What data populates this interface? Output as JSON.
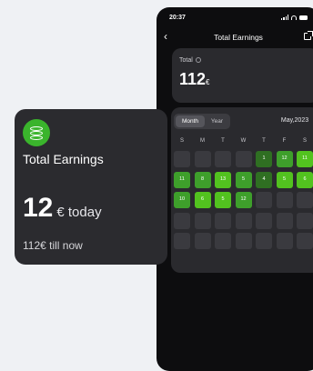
{
  "status_bar": {
    "time": "20:37"
  },
  "header": {
    "title": "Total Earnings",
    "back_icon": "chevron-left-icon",
    "share_icon": "share-icon"
  },
  "total_card": {
    "label": "Total",
    "info_icon": "info-icon",
    "value": "112",
    "currency": "€"
  },
  "calendar": {
    "tabs": [
      "Month",
      "Year"
    ],
    "active_tab": "Month",
    "month_label": "May,2023",
    "weekdays": [
      "S",
      "M",
      "T",
      "W",
      "T",
      "F",
      "S"
    ],
    "colors": {
      "empty": "#3a3a3f",
      "low": "#2f6f22",
      "mid": "#3e9f2b",
      "high": "#52c21f"
    },
    "rows": [
      [
        null,
        null,
        null,
        null,
        {
          "t": "1",
          "l": "low"
        },
        {
          "t": "12",
          "l": "mid"
        },
        {
          "t": "11",
          "l": "high"
        }
      ],
      [
        {
          "t": "11",
          "l": "mid"
        },
        {
          "t": "8",
          "l": "mid"
        },
        {
          "t": "13",
          "l": "high"
        },
        {
          "t": "5",
          "l": "mid"
        },
        {
          "t": "4",
          "l": "low"
        },
        {
          "t": "5",
          "l": "high"
        },
        {
          "t": "6",
          "l": "high"
        }
      ],
      [
        {
          "t": "10",
          "l": "mid"
        },
        {
          "t": "6",
          "l": "high"
        },
        {
          "t": "5",
          "l": "high"
        },
        {
          "t": "12",
          "l": "mid"
        },
        null,
        null,
        null
      ],
      [
        null,
        null,
        null,
        null,
        null,
        null,
        null
      ],
      [
        null,
        null,
        null,
        null,
        null,
        null,
        null
      ]
    ]
  },
  "earnings_card": {
    "icon": "coins-icon",
    "title": "Total Earnings",
    "today_value": "12",
    "today_unit": "€ today",
    "total_text": "112€ till now"
  }
}
